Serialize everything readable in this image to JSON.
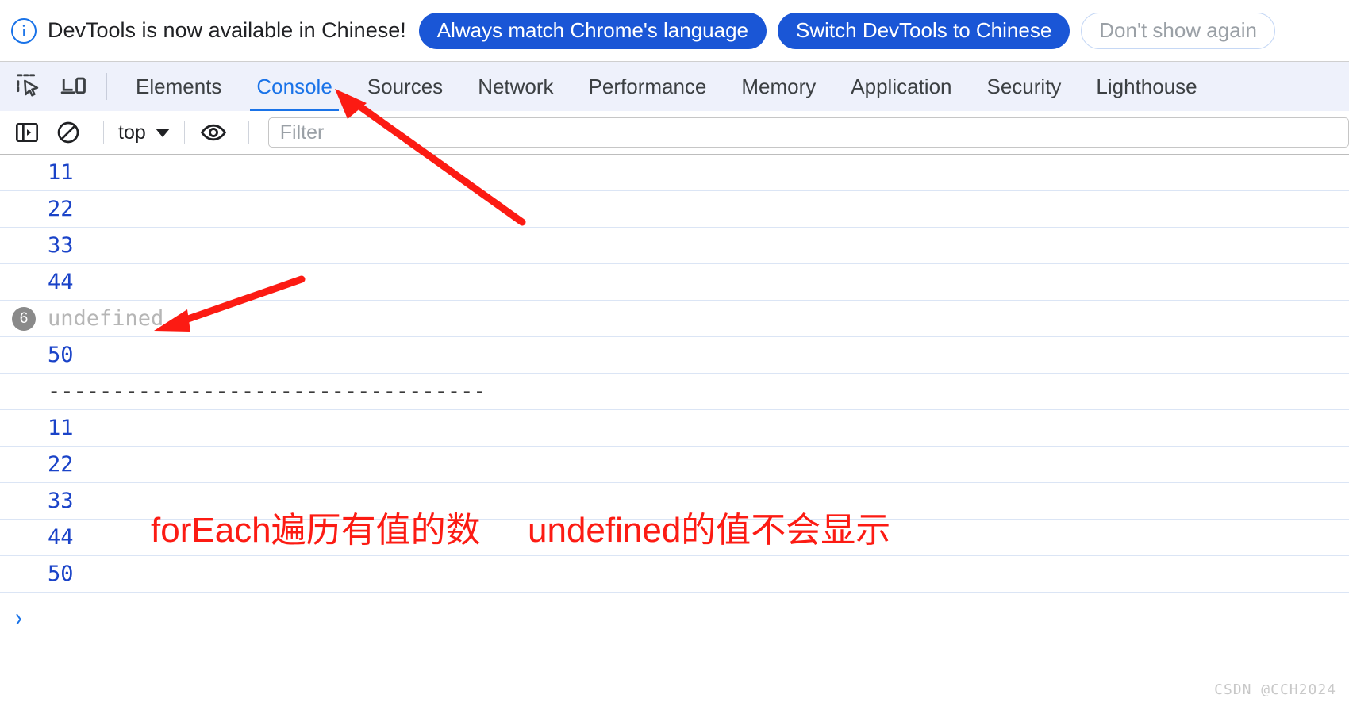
{
  "infobar": {
    "icon": "info-circle-icon",
    "message": "DevTools is now available in Chinese!",
    "buttons": [
      {
        "label": "Always match Chrome's language",
        "style": "primary"
      },
      {
        "label": "Switch DevTools to Chinese",
        "style": "primary"
      },
      {
        "label": "Don't show again",
        "style": "ghost"
      }
    ]
  },
  "tabstrip": {
    "icons": [
      {
        "name": "inspect-element-icon"
      },
      {
        "name": "device-toolbar-icon"
      }
    ],
    "tabs": [
      {
        "label": "Elements",
        "active": false
      },
      {
        "label": "Console",
        "active": true
      },
      {
        "label": "Sources",
        "active": false
      },
      {
        "label": "Network",
        "active": false
      },
      {
        "label": "Performance",
        "active": false
      },
      {
        "label": "Memory",
        "active": false
      },
      {
        "label": "Application",
        "active": false
      },
      {
        "label": "Security",
        "active": false
      },
      {
        "label": "Lighthouse",
        "active": false
      }
    ]
  },
  "console_toolbar": {
    "sidebar_toggle_icon": "console-sidebar-icon",
    "clear_icon": "clear-console-icon",
    "context_label": "top",
    "eye_icon": "live-expression-eye-icon",
    "filter_placeholder": "Filter",
    "filter_value": ""
  },
  "console_log": {
    "rows": [
      {
        "badge": "",
        "text": "11",
        "style": "value"
      },
      {
        "badge": "",
        "text": "22",
        "style": "value"
      },
      {
        "badge": "",
        "text": "33",
        "style": "value"
      },
      {
        "badge": "",
        "text": "44",
        "style": "value"
      },
      {
        "badge": "6",
        "text": "undefined",
        "style": "dim"
      },
      {
        "badge": "",
        "text": "50",
        "style": "value"
      },
      {
        "badge": "",
        "text": "----------------------------------",
        "style": "rule"
      },
      {
        "badge": "",
        "text": "11",
        "style": "value"
      },
      {
        "badge": "",
        "text": "22",
        "style": "value"
      },
      {
        "badge": "",
        "text": "33",
        "style": "value"
      },
      {
        "badge": "",
        "text": "44",
        "style": "value"
      },
      {
        "badge": "",
        "text": "50",
        "style": "value"
      }
    ],
    "prompt_symbol": "›"
  },
  "annotations": {
    "note_left": "forEach遍历有值的数",
    "note_right": "undefined的值不会显示",
    "arrow_color": "#fc1b13"
  },
  "watermark": "CSDN @CCH2024",
  "colors": {
    "accent_blue": "#1a73e8",
    "button_blue": "#1a56d6",
    "log_value_blue": "#1a43c8",
    "annotation_red": "#fc1b13",
    "tabstrip_bg": "#eef1fb",
    "row_divider": "#dbe5f5"
  }
}
